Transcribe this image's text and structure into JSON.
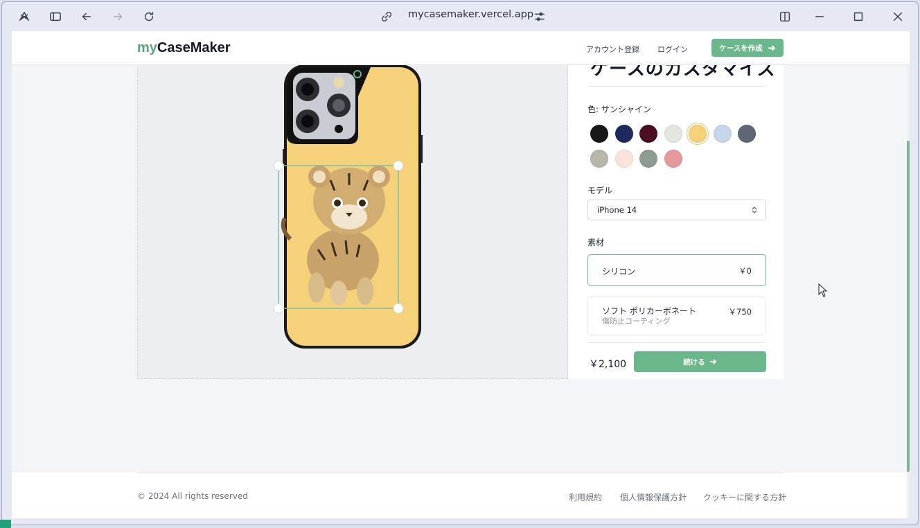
{
  "browser": {
    "url": "mycasemaker.vercel.app",
    "icons": [
      "app-icon",
      "sidebar-toggle-icon",
      "back-icon",
      "forward-icon",
      "reload-icon",
      "link-icon",
      "site-settings-icon",
      "split-view-icon",
      "minimize-icon",
      "maximize-icon",
      "close-icon"
    ]
  },
  "navbar": {
    "logo_prefix": "my",
    "logo_rest": "CaseMaker",
    "register": "アカウント登録",
    "login": "ログイン",
    "cta": "ケースを作成"
  },
  "panel": {
    "title": "ケースのカスタマイズ",
    "color_label": "色: サンシャイン",
    "colors": [
      "#18181b",
      "#1e2a5e",
      "#4a0f1e",
      "#e2e8e0",
      "#f5d27a",
      "#c9d5e8",
      "#5f6675",
      "#b8b6ab",
      "#fbe3d9",
      "#8e9c91",
      "#e6999a"
    ],
    "selected_color": "#f5d27a",
    "model_label": "モデル",
    "model_value": "iPhone 14",
    "material_label": "素材",
    "materials": [
      {
        "name": "シリコン",
        "price": "￥0",
        "sub": ""
      },
      {
        "name": "ソフト ポリカーボネート",
        "price": "￥750",
        "sub": "傷防止コーティング"
      }
    ],
    "total": "￥2,100",
    "continue": "続ける"
  },
  "footer": {
    "copyright": "© 2024 All rights reserved",
    "links": [
      "利用規約",
      "個人情報保護方針",
      "クッキーに関する方針"
    ]
  }
}
